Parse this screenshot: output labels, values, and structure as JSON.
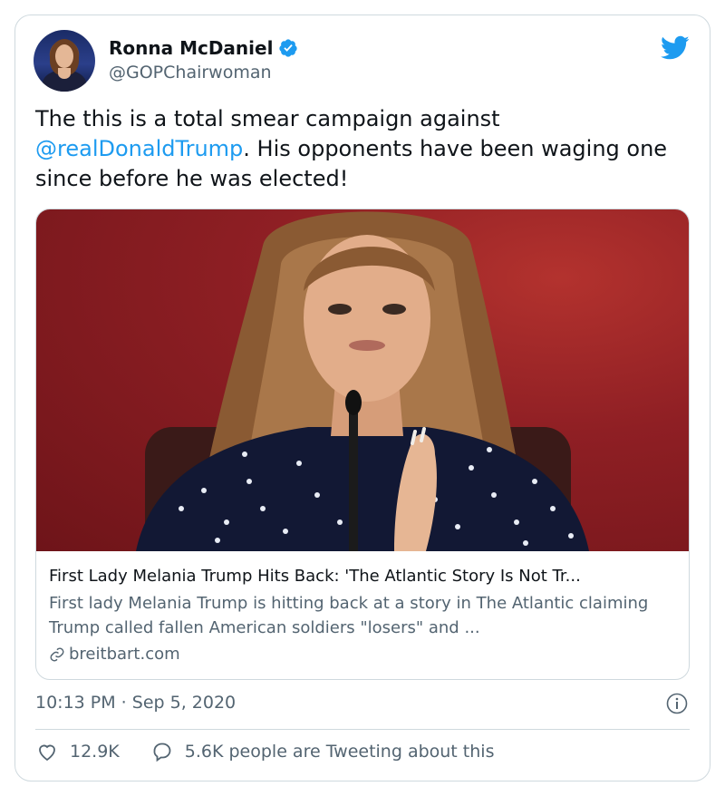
{
  "author": {
    "name": "Ronna McDaniel",
    "handle": "@GOPChairwoman"
  },
  "tweet": {
    "text_before": "The this is a total smear campaign against ",
    "mention": "@realDonaldTrump",
    "text_after": ". His opponents have been waging one since before he was elected!"
  },
  "link_card": {
    "title": "First Lady Melania Trump Hits Back: 'The Atlantic Story Is Not Tr...",
    "description": "First lady Melania Trump is hitting back at a story in The Atlantic claiming Trump called fallen American soldiers \"losers\" and ...",
    "domain": "breitbart.com"
  },
  "meta": {
    "timestamp": "10:13 PM · Sep 5, 2020"
  },
  "actions": {
    "likes": "12.9K",
    "replies_text": "5.6K people are Tweeting about this"
  },
  "colors": {
    "accent": "#1d9bf0",
    "secondary_text": "#536471",
    "border": "#cfd9de"
  },
  "icons": [
    "verified-badge-icon",
    "twitter-bird-icon",
    "link-icon",
    "info-icon",
    "heart-icon",
    "reply-bubble-icon"
  ]
}
